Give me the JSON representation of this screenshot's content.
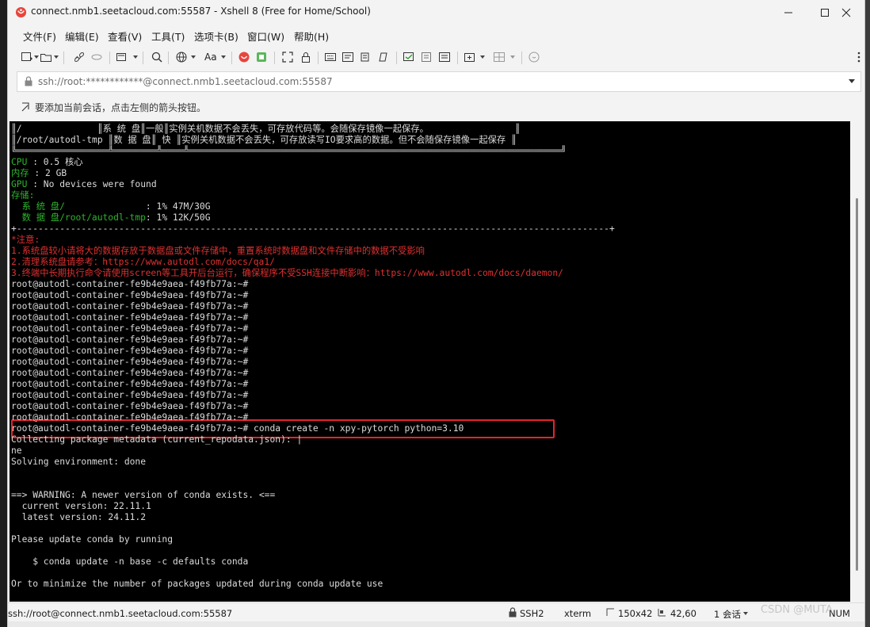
{
  "window": {
    "title": "connect.nmb1.seetacloud.com:55587 - Xshell 8 (Free for Home/School)",
    "accent": "#e5252a"
  },
  "menu": [
    "文件(F)",
    "编辑(E)",
    "查看(V)",
    "工具(T)",
    "选项卡(B)",
    "窗口(W)",
    "帮助(H)"
  ],
  "toolbar": {
    "icons": [
      "new-session-icon",
      "open-folder-icon",
      "disconnect-icon",
      "reconnect-icon",
      "new-window-icon",
      "search-icon",
      "globe-icon",
      "font-icon",
      "xshell-logo-icon",
      "xftp-icon",
      "fullscreen-icon",
      "lock-icon",
      "keyboard-icon",
      "compose-icon",
      "script-icon",
      "quick-command-icon",
      "log-icon",
      "highlight-icon",
      "add-tab-icon",
      "layout-icon",
      "help-icon"
    ],
    "font_label": "Aa"
  },
  "address": {
    "value": "ssh://root:************@connect.nmb1.seetacloud.com:55587"
  },
  "session_hint": "要添加当前会话，点击左侧的箭头按钮。",
  "terminal": {
    "lines": [
      {
        "text": "║/              ║系 统 盘║一般║实例关机数据不会丢失，可存放代码等。会随保存镜像一起保存。                ║",
        "color": "w"
      },
      {
        "text": "║/root/autodl-tmp ║数 据 盘║ 快 ║实例关机数据不会丢失，可存放读写IO要求高的数据。但不会随保存镜像一起保存 ║",
        "color": "w"
      },
      {
        "text": "╚═════════════════╩════════╩════╩═════════════════════════════════════════════════════════════════════╝",
        "color": "w"
      },
      {
        "parts": [
          {
            "t": "CPU",
            "c": "g"
          },
          {
            "t": " : 0.5 核心",
            "c": "w"
          }
        ]
      },
      {
        "parts": [
          {
            "t": "内存",
            "c": "g"
          },
          {
            "t": " : 2 GB",
            "c": "w"
          }
        ]
      },
      {
        "parts": [
          {
            "t": "GPU",
            "c": "g"
          },
          {
            "t": " : No devices were found",
            "c": "w"
          }
        ]
      },
      {
        "parts": [
          {
            "t": "存储:",
            "c": "g"
          }
        ]
      },
      {
        "parts": [
          {
            "t": "  系 统 盘/               ",
            "c": "g"
          },
          {
            "t": ": 1% 47M/30G",
            "c": "w"
          }
        ]
      },
      {
        "parts": [
          {
            "t": "  数 据 盘/root/autodl-tmp",
            "c": "g"
          },
          {
            "t": ": 1% 12K/50G",
            "c": "w"
          }
        ]
      },
      {
        "text": "+--------------------------------------------------------------------------------------------------------------+",
        "color": "w"
      },
      {
        "text": "*注意:",
        "color": "r"
      },
      {
        "text": "1.系统盘较小请将大的数据存放于数据盘或文件存储中，重置系统时数据盘和文件存储中的数据不受影响",
        "color": "r"
      },
      {
        "text": "2.清理系统盘请参考：https://www.autodl.com/docs/qa1/",
        "color": "r"
      },
      {
        "text": "3.终端中长期执行命令请使用screen等工具开后台运行，确保程序不受SSH连接中断影响：https://www.autodl.com/docs/daemon/",
        "color": "r"
      },
      {
        "text": "root@autodl-container-fe9b4e9aea-f49fb77a:~#",
        "color": "w"
      },
      {
        "text": "root@autodl-container-fe9b4e9aea-f49fb77a:~#",
        "color": "w"
      },
      {
        "text": "root@autodl-container-fe9b4e9aea-f49fb77a:~#",
        "color": "w"
      },
      {
        "text": "root@autodl-container-fe9b4e9aea-f49fb77a:~#",
        "color": "w"
      },
      {
        "text": "root@autodl-container-fe9b4e9aea-f49fb77a:~#",
        "color": "w"
      },
      {
        "text": "root@autodl-container-fe9b4e9aea-f49fb77a:~#",
        "color": "w"
      },
      {
        "text": "root@autodl-container-fe9b4e9aea-f49fb77a:~#",
        "color": "w"
      },
      {
        "text": "root@autodl-container-fe9b4e9aea-f49fb77a:~#",
        "color": "w"
      },
      {
        "text": "root@autodl-container-fe9b4e9aea-f49fb77a:~#",
        "color": "w"
      },
      {
        "text": "root@autodl-container-fe9b4e9aea-f49fb77a:~#",
        "color": "w"
      },
      {
        "text": "root@autodl-container-fe9b4e9aea-f49fb77a:~#",
        "color": "w"
      },
      {
        "text": "root@autodl-container-fe9b4e9aea-f49fb77a:~#",
        "color": "w"
      },
      {
        "text": "root@autodl-container-fe9b4e9aea-f49fb77a:~#",
        "color": "w"
      },
      {
        "text": "root@autodl-container-fe9b4e9aea-f49fb77a:~# conda create -n xpy-pytorch python=3.10",
        "color": "w"
      },
      {
        "text": "Collecting package metadata (current_repodata.json): |                                                                                                                                  do",
        "color": "w"
      },
      {
        "text": "ne",
        "color": "w"
      },
      {
        "text": "Solving environment: done",
        "color": "w"
      },
      {
        "text": "",
        "color": "w"
      },
      {
        "text": "",
        "color": "w"
      },
      {
        "text": "==> WARNING: A newer version of conda exists. <==",
        "color": "w"
      },
      {
        "text": "  current version: 22.11.1",
        "color": "w"
      },
      {
        "text": "  latest version: 24.11.2",
        "color": "w"
      },
      {
        "text": "",
        "color": "w"
      },
      {
        "text": "Please update conda by running",
        "color": "w"
      },
      {
        "text": "",
        "color": "w"
      },
      {
        "text": "    $ conda update -n base -c defaults conda",
        "color": "w"
      },
      {
        "text": "",
        "color": "w"
      },
      {
        "text": "Or to minimize the number of packages updated during conda update use",
        "color": "w"
      }
    ]
  },
  "status": {
    "connection": "ssh://root@connect.nmb1.seetacloud.com:55587",
    "protocol": "SSH2",
    "terminal_type": "xterm",
    "size": "150x42",
    "cursor": "42,60",
    "sessions": "1 会话",
    "numlock": "NUM"
  },
  "watermark": "CSDN @MUTA"
}
